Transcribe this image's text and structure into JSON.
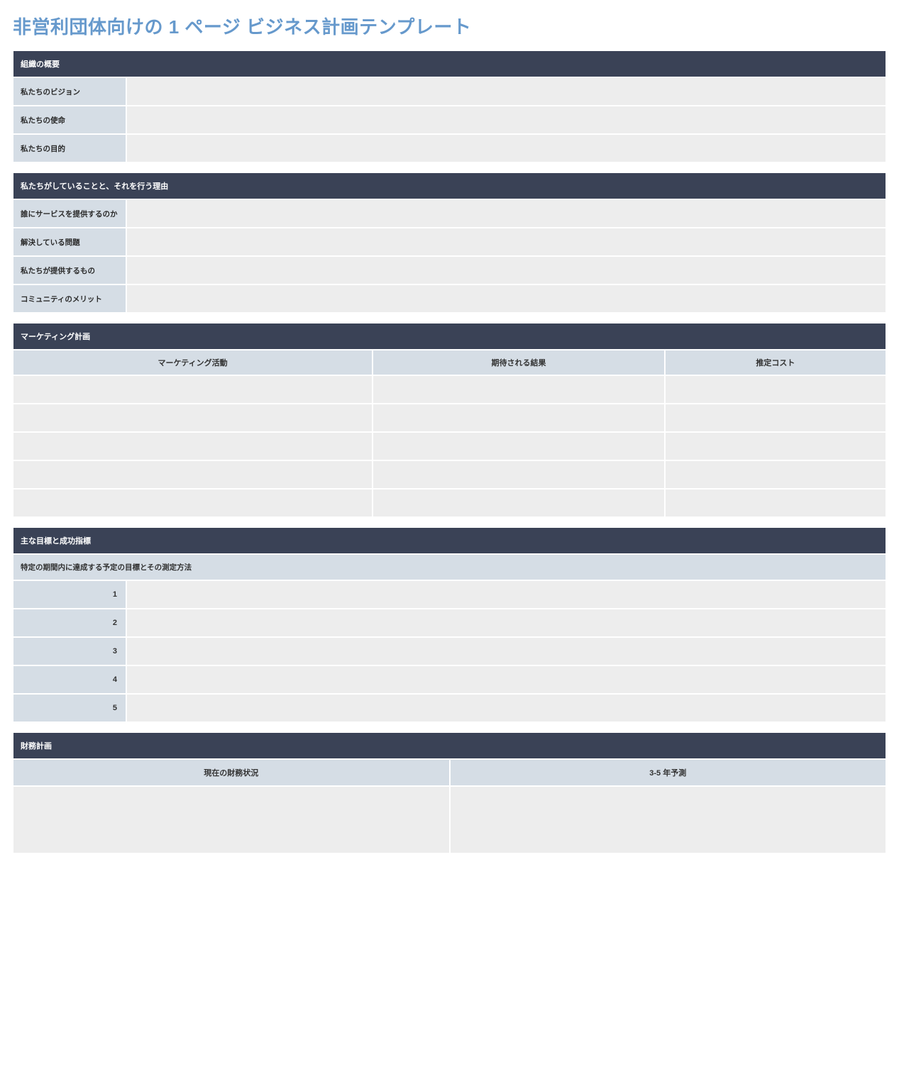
{
  "title": "非営利団体向けの 1 ページ ビジネス計画テンプレート",
  "sections": {
    "org": {
      "header": "組織の概要",
      "rows": [
        {
          "label": "私たちのビジョン",
          "value": ""
        },
        {
          "label": "私たちの使命",
          "value": ""
        },
        {
          "label": "私たちの目的",
          "value": ""
        }
      ]
    },
    "what": {
      "header": "私たちがしていることと、それを行う理由",
      "rows": [
        {
          "label": "誰にサービスを提供するのか",
          "value": ""
        },
        {
          "label": "解決している問題",
          "value": ""
        },
        {
          "label": "私たちが提供するもの",
          "value": ""
        },
        {
          "label": "コミュニティのメリット",
          "value": ""
        }
      ]
    },
    "marketing": {
      "header": "マーケティング計画",
      "cols": [
        "マーケティング活動",
        "期待される結果",
        "推定コスト"
      ],
      "rows": [
        {
          "c0": "",
          "c1": "",
          "c2": ""
        },
        {
          "c0": "",
          "c1": "",
          "c2": ""
        },
        {
          "c0": "",
          "c1": "",
          "c2": ""
        },
        {
          "c0": "",
          "c1": "",
          "c2": ""
        },
        {
          "c0": "",
          "c1": "",
          "c2": ""
        }
      ]
    },
    "goals": {
      "header": "主な目標と成功指標",
      "subheader": "特定の期間内に達成する予定の目標とその測定方法",
      "rows": [
        {
          "num": "1",
          "value": ""
        },
        {
          "num": "2",
          "value": ""
        },
        {
          "num": "3",
          "value": ""
        },
        {
          "num": "4",
          "value": ""
        },
        {
          "num": "5",
          "value": ""
        }
      ]
    },
    "finance": {
      "header": "財務計画",
      "cols": [
        "現在の財務状況",
        "3-5 年予測"
      ],
      "row": {
        "c0": "",
        "c1": ""
      }
    }
  }
}
